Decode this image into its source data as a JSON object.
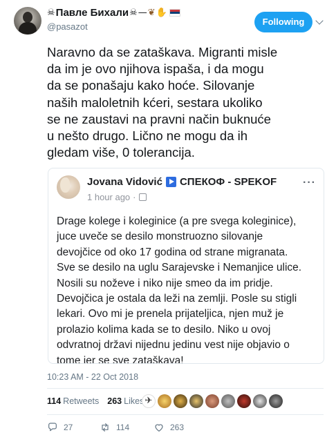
{
  "header": {
    "display_name": "Павле Бихали",
    "username": "@pasazot",
    "follow_label": "Following"
  },
  "tweet": {
    "lines": [
      "Naravno da se zataškava. Migranti misle",
      "da im je ovo njihova ispaša, i da mogu",
      "da se ponašaju kako hoće. Silovanje",
      "naših maloletnih kćeri, sestara ukoliko",
      "se ne zaustavi na pravni način buknuće",
      "u nešto drugo. Lično ne mogu da ih",
      "gledam više, 0 tolerancija."
    ]
  },
  "card": {
    "author": "Jovana Vidović",
    "page": "СПЕКОФ - SPEKOF",
    "time": "1 hour ago",
    "more": "···",
    "lines": [
      "Drage kolege i koleginice (a pre svega koleginice),",
      "juce uveče se desilo monstruozno silovanje",
      "devojčice od oko 17 godina od strane migranata.",
      "Sve se desilo na uglu Sarajevske i Nemanjice ulice.",
      "Nosili su noževe i niko nije smeo da im pridje.",
      "Devojčica je ostala da leži na zemlji. Posle su stigli",
      "lekari. Ovo mi je prenela prijateljica, njen muž je",
      "prolazio kolima kada se to desilo. Niko u ovoj",
      "odvratnoj državi nijednu jedinu vest nije objavio o",
      "tome jer se sve zataškava!"
    ]
  },
  "timestamp": "10:23 AM - 22 Oct 2018",
  "stats": {
    "retweets_count": "114",
    "retweets_label": "Retweets",
    "likes_count": "263",
    "likes_label": "Likes"
  },
  "actions": {
    "replies": "27",
    "retweets": "114",
    "likes": "263"
  },
  "colors": {
    "accent": "#1da1f2",
    "text": "#14171a",
    "muted": "#657786",
    "flag": [
      "#c6363c",
      "#0c4076",
      "#ffffff"
    ]
  },
  "icons": [
    "skull-crossbones-icon",
    "paw-prints-icon",
    "raised-hand-icon",
    "serbia-flag-icon",
    "chevron-down-icon",
    "play-badge-icon",
    "globe-icon",
    "reply-icon",
    "retweet-icon",
    "heart-icon"
  ]
}
